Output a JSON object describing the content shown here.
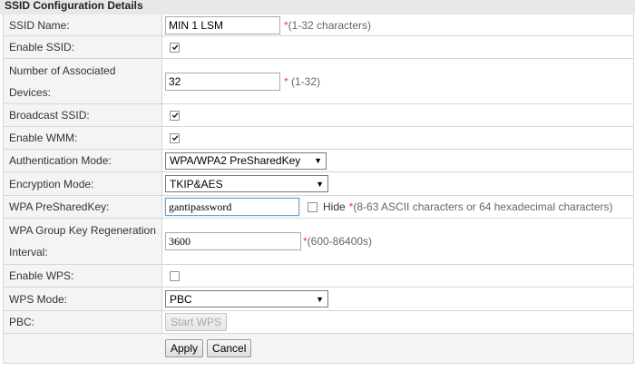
{
  "section_title": "SSID Configuration Details",
  "fields": {
    "ssid_name": {
      "label": "SSID Name:",
      "value": "MIN 1 LSM",
      "required": "*",
      "hint": "(1-32 characters)"
    },
    "enable_ssid": {
      "label": "Enable SSID:",
      "checked": true
    },
    "assoc_devices": {
      "label_line1": "Number of Associated",
      "label_line2": "Devices:",
      "value": "32",
      "required": "*",
      "hint": "(1-32)"
    },
    "broadcast_ssid": {
      "label": "Broadcast SSID:",
      "checked": true
    },
    "enable_wmm": {
      "label": "Enable WMM:",
      "checked": true
    },
    "auth_mode": {
      "label": "Authentication Mode:",
      "selected": "WPA/WPA2 PreSharedKey"
    },
    "encryption_mode": {
      "label": "Encryption Mode:",
      "selected": "TKIP&AES"
    },
    "wpa_psk": {
      "label": "WPA PreSharedKey:",
      "value": "gantipassword",
      "hide_label": "Hide",
      "hide_checked": false,
      "required": "*",
      "hint": "(8-63 ASCII characters or 64 hexadecimal characters)"
    },
    "group_key": {
      "label_line1": "WPA Group Key Regeneration",
      "label_line2": "Interval:",
      "value": "3600",
      "required": "*",
      "hint": "(600-86400s)"
    },
    "enable_wps": {
      "label": "Enable WPS:",
      "checked": false
    },
    "wps_mode": {
      "label": "WPS Mode:",
      "selected": "PBC"
    },
    "pbc": {
      "label": "PBC:",
      "button": "Start WPS"
    }
  },
  "buttons": {
    "apply": "Apply",
    "cancel": "Cancel"
  }
}
